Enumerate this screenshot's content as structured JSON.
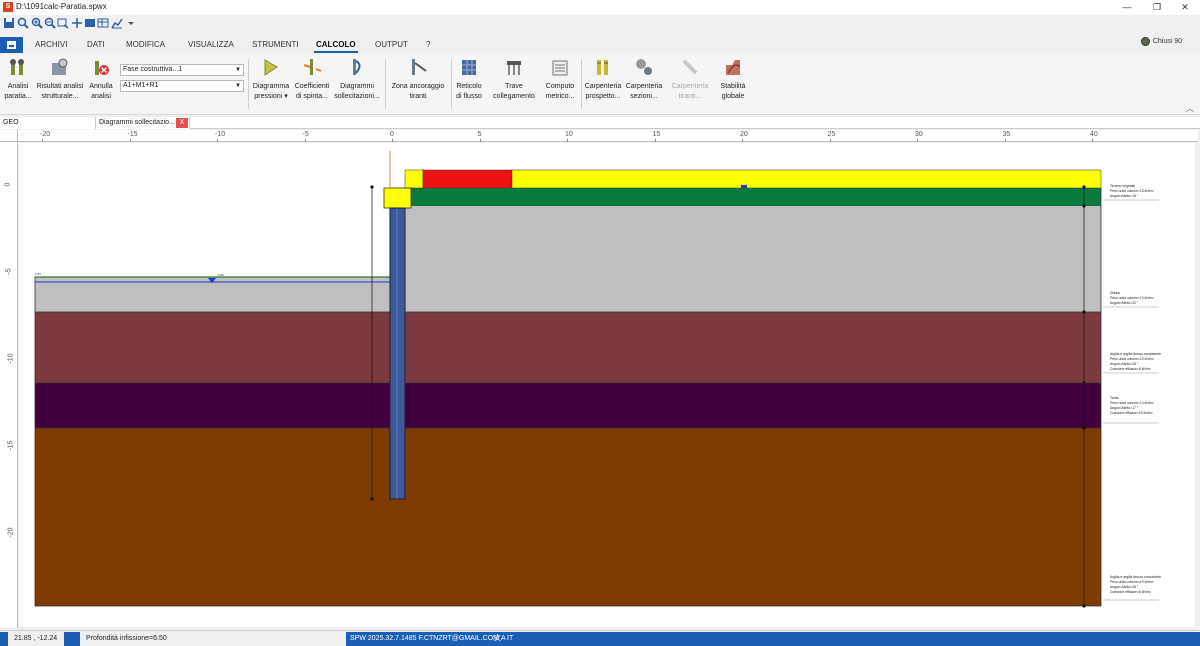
{
  "window": {
    "title": "D:\\1091calc-Paratia.spwx",
    "app_icon": "S",
    "min": "—",
    "max": "❐",
    "close": "✕"
  },
  "menu": {
    "tabs": [
      "ARCHIVI",
      "DATI",
      "MODIFICA",
      "VISUALIZZA",
      "STRUMENTI",
      "CALCOLO",
      "OUTPUT",
      "?"
    ],
    "active": "CALCOLO",
    "user": "Chiusi 90"
  },
  "ribbon": {
    "analisi_label": "Analisi",
    "analisi_label2": "paratia...",
    "risultati_label": "Risultati analisi",
    "risultati_label2": "strutturale...",
    "annulla_label": "Annulla",
    "annulla_label2": "analisi",
    "fase_select": "Fase costruttiva...1",
    "comb_select": "A1+M1+R1",
    "diagramma_label": "Diagramma",
    "diagramma_label2": "pressioni ▾",
    "coeff_label": "Coefficienti",
    "coeff_label2": "di spinta...",
    "diagrammi_label": "Diagrammi",
    "diagrammi_label2": "sollecitazioni...",
    "zona_label": "Zona ancoraggio",
    "zona_label2": "tiranti",
    "reticolo_label": "Reticolo",
    "reticolo_label2": "di flusso",
    "trave_label": "Trave",
    "trave_label2": "collegamento",
    "computo_label": "Computo",
    "computo_label2": "metrico...",
    "carp_prosp_label": "Carpenteria",
    "carp_prosp_label2": "prospetto...",
    "carp_sez_label": "Carpenteria",
    "carp_sez_label2": "sezioni...",
    "carp_tir_label": "Carpenteria",
    "carp_tir_label2": "tiranti...",
    "stab_label": "Stabilità",
    "stab_label2": "globale"
  },
  "doc_tabs": {
    "geo": "GEO",
    "diagrammi": "Diagrammi sollecitazio...",
    "close": "X"
  },
  "rulers": {
    "x_ticks": [
      "-20",
      "-15",
      "-10",
      "-5",
      "0",
      "5",
      "10",
      "15",
      "20",
      "25",
      "30",
      "35",
      "40"
    ],
    "y_ticks": [
      "0",
      "-5",
      "-10",
      "-15",
      "-20"
    ]
  },
  "drawing": {
    "colors": {
      "load_yellow": "#ffff00",
      "load_red": "#ee1111",
      "layer_green": "#0b7a3e",
      "layer_gray": "#bfbfc2",
      "layer_maroon": "#7d3a3e",
      "layer_purple": "#42003f",
      "layer_brown": "#7f3c02",
      "wall_blue": "#3c5a9a"
    },
    "layers": [
      {
        "name": "Terreno vegetale",
        "line1": "Peso unità volume=18 kN/m³",
        "line2": "Angolo Attrito=18 °"
      },
      {
        "name": "Ghiaia",
        "line1": "Peso unità volume=19 kN/m³",
        "line2": "Angolo Attrito=32 °"
      },
      {
        "name": "Argilla e argilla limosa consistente",
        "line1": "Peso unità volume=19 kN/m³",
        "line2": "Angolo Attrito=28 °",
        "line3": "Coesione efficace=8 kN/m²"
      },
      {
        "name": "Torba",
        "line1": "Peso unità volume=14 kN/m³",
        "line2": "Angolo Attrito=17 °",
        "line3": "Coesione efficace=15 kN/m²"
      },
      {
        "name": "Argilla e argilla limosa consistente",
        "line1": "Peso unità volume=19 kN/m³",
        "line2": "Angolo Attrito=28 °",
        "line3": "Coesione efficace=8 kN/m²"
      }
    ]
  },
  "status": {
    "coords": "21.85 , -12.24",
    "message": "Profondità infissione=6.50",
    "license": "SPW 2025.32.7.1485 F.CTNZRT@GMAIL.COM",
    "lang": "IT"
  }
}
